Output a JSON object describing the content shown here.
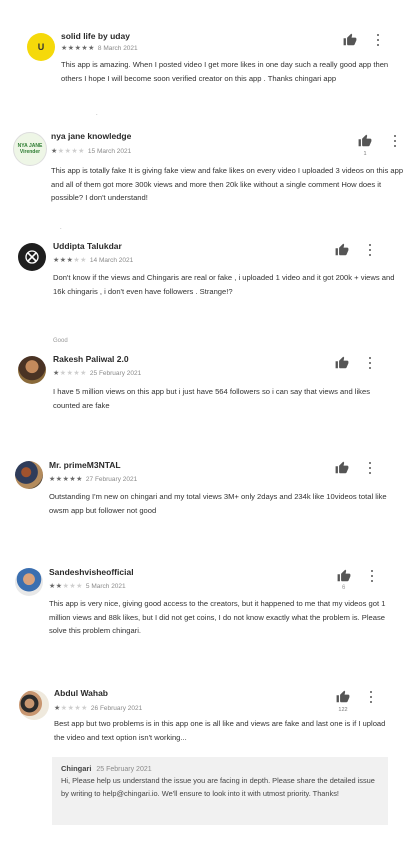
{
  "icons": {
    "thumb": "thumbs-up-icon",
    "more": "more-vert-icon",
    "star": "star-icon"
  },
  "colors": {
    "star_on": "#6a6a6a",
    "star_off": "#cfcfcf",
    "reply_bg": "#f1f1f1",
    "avatar_yellow": "#f5d90a"
  },
  "reviews": [
    {
      "name": "solid life by uday",
      "avatar_text": "U",
      "rating": 5,
      "date": "8 March 2021",
      "helpful_count": "",
      "text": "This app is amazing. When I posted video I get more likes in one day such a really good app then others I hope I will become soon verified creator on this app . Thanks chingari app"
    },
    {
      "name": "nya jane knowledge",
      "avatar_text": "NYA JANE Virender",
      "rating": 1,
      "date": "15 March 2021",
      "helpful_count": "1",
      "text": "This app is totally fake It is giving fake view and fake likes on every video I uploaded 3 videos on this app and all of them got more 300k views and more then 20k like without a single comment How does it possible? I don't understand!"
    },
    {
      "name": "Uddipta Talukdar",
      "avatar_text": "",
      "rating": 3,
      "date": "14 March 2021",
      "helpful_count": "",
      "text": "Don't know if the views and Chingaris are real or fake , i uploaded 1 video and it got 200k + views and 16k chingaris , i don't even have followers . Strange!?"
    },
    {
      "name": "Rakesh Paliwal 2.0",
      "avatar_text": "",
      "rating": 1,
      "date": "25 February 2021",
      "helpful_count": "",
      "text": "I have 5 million views on this app but i just have 564 followers so i can say that views and likes counted are fake"
    },
    {
      "name": "Mr. primeM3NTAL",
      "avatar_text": "",
      "rating": 5,
      "date": "27 February 2021",
      "helpful_count": "",
      "text": "Outstanding I'm new on chingari and my total views 3M+ only 2days and 234k like 10videos total like owsm app but follower not good"
    },
    {
      "name": "Sandeshvisheofficial",
      "avatar_text": "",
      "rating": 2,
      "date": "5 March 2021",
      "helpful_count": "",
      "text": "This app is very nice, giving good access to the creators, but it happened to me that my videos got 1 million views and 88k likes, but I did not get coins, I do not know exactly what the problem is. Please solve this problem chingari."
    },
    {
      "name": "Abdul Wahab",
      "avatar_text": "",
      "rating": 1,
      "date": "26 February 2021",
      "helpful_count": "122",
      "text": "Best app but two problems is in this app one is all like and views are fake and last one is if I upload the video and text option isn't working..."
    }
  ],
  "reply": {
    "author": "Chingari",
    "date": "25 February 2021",
    "text": "Hi, Please help us understand the issue you are facing in depth. Please share the detailed issue by writing to help@chingari.io. We'll ensure to look into it with utmost priority. Thanks!"
  },
  "stray_marks": [
    ".",
    ".",
    "Good",
    "6"
  ]
}
